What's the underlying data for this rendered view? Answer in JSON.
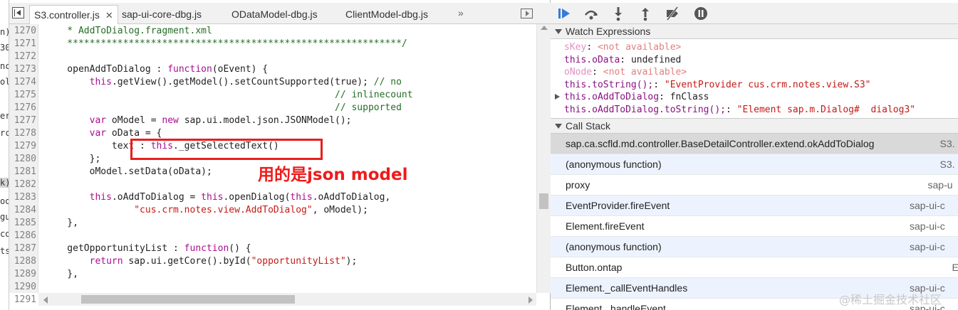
{
  "left_strip": [
    "n)",
    "30",
    "nc",
    "ol",
    "er",
    "rc",
    "k)",
    "oo",
    "gu",
    "co",
    "ts"
  ],
  "tabs": [
    {
      "label": "S3.controller.js",
      "close": "✕"
    },
    {
      "label": "sap-ui-core-dbg.js"
    },
    {
      "label": "ODataModel-dbg.js"
    },
    {
      "label": "ClientModel-dbg.js"
    }
  ],
  "tabs_more": "»",
  "code_lines": [
    {
      "n": "1270",
      "t": "    * AddToDialog.fragment.xml",
      "c": "cm"
    },
    {
      "n": "1271",
      "t": "    ************************************************************/",
      "c": "cm"
    },
    {
      "n": "1272",
      "t": ""
    },
    {
      "n": "1273",
      "parts": [
        {
          "t": "    openAddToDialog : "
        },
        {
          "t": "function",
          "c": "kw"
        },
        {
          "t": "(oEvent) {"
        }
      ]
    },
    {
      "n": "1274",
      "parts": [
        {
          "t": "        "
        },
        {
          "t": "this",
          "c": "kw"
        },
        {
          "t": ".getView().getModel().setCountSupported(true); "
        },
        {
          "t": "// no",
          "c": "cm"
        }
      ]
    },
    {
      "n": "1275",
      "t": "                                                    // inlinecount",
      "c": "cm"
    },
    {
      "n": "1276",
      "t": "                                                    // supported",
      "c": "cm"
    },
    {
      "n": "1277",
      "parts": [
        {
          "t": "        "
        },
        {
          "t": "var",
          "c": "kw"
        },
        {
          "t": " oModel = "
        },
        {
          "t": "new",
          "c": "kw"
        },
        {
          "t": " sap.ui.model.json.JSONModel();"
        }
      ]
    },
    {
      "n": "1278",
      "parts": [
        {
          "t": "        "
        },
        {
          "t": "var",
          "c": "kw"
        },
        {
          "t": " oData = {"
        }
      ]
    },
    {
      "n": "1279",
      "parts": [
        {
          "t": "            text : "
        },
        {
          "t": "this",
          "c": "kw"
        },
        {
          "t": "._getSelectedText()"
        }
      ]
    },
    {
      "n": "1280",
      "t": "        };"
    },
    {
      "n": "1281",
      "t": "        oModel.setData(oData);"
    },
    {
      "n": "1282",
      "t": ""
    },
    {
      "n": "1283",
      "parts": [
        {
          "t": "        "
        },
        {
          "t": "this",
          "c": "kw"
        },
        {
          "t": ".oAddToDialog = "
        },
        {
          "t": "this",
          "c": "kw"
        },
        {
          "t": ".openDialog("
        },
        {
          "t": "this",
          "c": "kw"
        },
        {
          "t": ".oAddToDialog,"
        }
      ]
    },
    {
      "n": "1284",
      "parts": [
        {
          "t": "                "
        },
        {
          "t": "\"cus.crm.notes.view.AddToDialog\"",
          "c": "str"
        },
        {
          "t": ", oModel);"
        }
      ]
    },
    {
      "n": "1285",
      "t": "    },"
    },
    {
      "n": "1286",
      "t": ""
    },
    {
      "n": "1287",
      "parts": [
        {
          "t": "    getOpportunityList : "
        },
        {
          "t": "function",
          "c": "kw"
        },
        {
          "t": "() {"
        }
      ]
    },
    {
      "n": "1288",
      "parts": [
        {
          "t": "        "
        },
        {
          "t": "return",
          "c": "kw"
        },
        {
          "t": " sap.ui.getCore().byId("
        },
        {
          "t": "\"opportunityList\"",
          "c": "str"
        },
        {
          "t": ");"
        }
      ]
    },
    {
      "n": "1289",
      "t": "    },"
    },
    {
      "n": "1290",
      "t": ""
    },
    {
      "n": "1291",
      "t": ""
    }
  ],
  "annotation": "用的是json model",
  "watch": {
    "title": "Watch Expressions",
    "rows": [
      {
        "name": "sKey",
        "sep": ": ",
        "value": "<not available>",
        "kind": "na"
      },
      {
        "name": "this.oData",
        "sep": ": ",
        "value": "undefined",
        "kind": "plain"
      },
      {
        "name": "oNode",
        "sep": ": ",
        "value": "<not available>",
        "kind": "na"
      },
      {
        "name": "this.toString();",
        "sep": ": ",
        "value": "\"EventProvider cus.crm.notes.view.S3\"",
        "kind": "str"
      },
      {
        "name": "this.oAddToDialog",
        "sep": ": ",
        "value": "fnClass",
        "kind": "plain",
        "expandable": true
      },
      {
        "name": "this.oAddToDialog.toString();",
        "sep": ": ",
        "value": "\"Element sap.m.Dialog#  dialog3\"",
        "kind": "str"
      }
    ]
  },
  "callstack": {
    "title": "Call Stack",
    "rows": [
      {
        "fn": "sap.ca.scfld.md.controller.BaseDetailController.extend.okAddToDialog",
        "loc": "S3."
      },
      {
        "fn": "(anonymous function)",
        "loc": "S3."
      },
      {
        "fn": "proxy",
        "loc": "sap-u"
      },
      {
        "fn": "EventProvider.fireEvent",
        "loc": "sap-ui-c"
      },
      {
        "fn": "Element.fireEvent",
        "loc": "sap-ui-c"
      },
      {
        "fn": "(anonymous function)",
        "loc": "sap-ui-c"
      },
      {
        "fn": "Button.ontap",
        "loc": "E"
      },
      {
        "fn": "Element._callEventHandles",
        "loc": "sap-ui-c"
      },
      {
        "fn": "Element._handleEvent",
        "loc": "sap-ui-c"
      }
    ]
  },
  "watermark": "@稀土掘金技术社区",
  "colors": {
    "accent": "#3879d9",
    "annotation": "#ee1b1b"
  }
}
